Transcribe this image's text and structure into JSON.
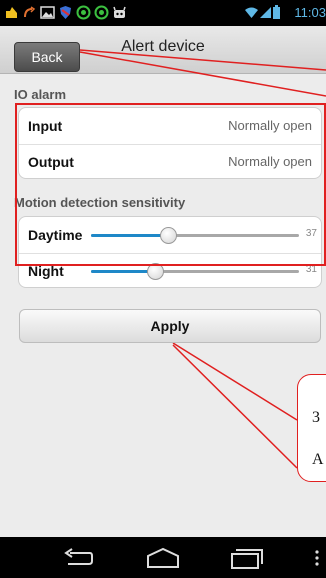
{
  "status_bar": {
    "time": "11:03",
    "icons": [
      "notification-icon",
      "missed-call-icon",
      "image-icon",
      "shield-app-icon",
      "circle-app-icon",
      "circle-app-icon",
      "android-icon",
      "wifi-icon",
      "signal-icon",
      "battery-icon"
    ]
  },
  "header": {
    "title": "Alert device",
    "back_label": "Back"
  },
  "io_alarm": {
    "section_label": "IO alarm",
    "rows": [
      {
        "label": "Input",
        "value": "Normally open"
      },
      {
        "label": "Output",
        "value": "Normally open"
      }
    ]
  },
  "motion": {
    "section_label": "Motion detection sensitivity",
    "sliders": [
      {
        "label": "Daytime",
        "value": "37",
        "fraction": 0.37
      },
      {
        "label": "Night",
        "value": "31",
        "fraction": 0.31
      }
    ]
  },
  "apply_label": "Apply",
  "annotation": {
    "line1": "3",
    "line2": "A",
    "color": "#e02020"
  },
  "nav_bar": {
    "icons": [
      "back-icon",
      "home-icon",
      "recent-apps-icon",
      "overflow-menu-icon"
    ]
  }
}
